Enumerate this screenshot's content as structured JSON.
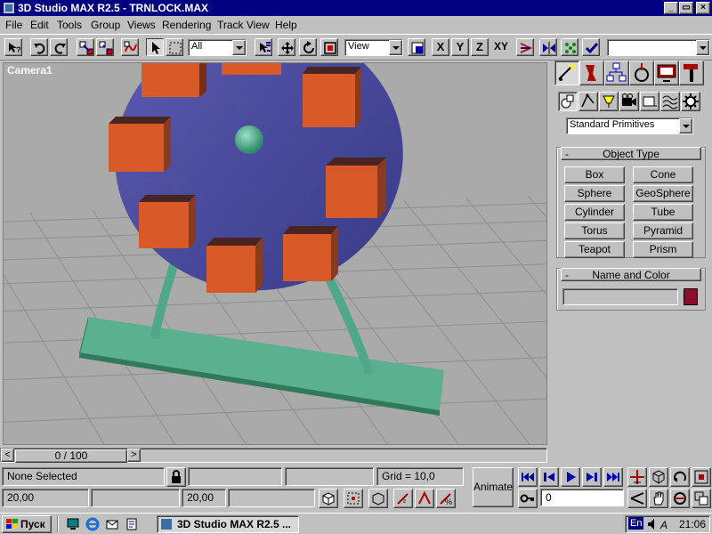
{
  "window": {
    "title": "3D Studio MAX R2.5 - TRNLOCK.MAX",
    "min_label": "_",
    "max_label": "▭",
    "close_label": "×"
  },
  "menu": [
    "File",
    "Edit",
    "Tools",
    "Group",
    "Views",
    "Rendering",
    "Track View",
    "Help"
  ],
  "toolbar": {
    "selection_filter": "All",
    "reference_coord": "View",
    "axis_x": "X",
    "axis_y": "Y",
    "axis_z": "Z",
    "axis_xy": "XY",
    "named_selection": ""
  },
  "viewport": {
    "label": "Camera1"
  },
  "command_panel": {
    "category": "Standard Primitives",
    "object_type_title": "Object Type",
    "buttons": [
      "Box",
      "Cone",
      "Sphere",
      "GeoSphere",
      "Cylinder",
      "Tube",
      "Torus",
      "Pyramid",
      "Teapot",
      "Prism"
    ],
    "name_color_title": "Name and Color",
    "name_value": "",
    "color": "#8b0f2a",
    "rollout_collapse": "-"
  },
  "time_slider": {
    "position": "0 / 100",
    "left_arrow": "<",
    "right_arrow": ">"
  },
  "status": {
    "selection": "None Selected",
    "grid": "Grid = 10,0",
    "coord_x": "20,00",
    "coord_y": "20,00",
    "animate_label": "Animate",
    "frame_value": "0"
  },
  "taskbar": {
    "start_label": "Пуск",
    "task_label": "3D Studio MAX R2.5 ...",
    "lang": "En",
    "clock": "21:06"
  },
  "colors": {
    "titlebar": "#000080",
    "wheel": "#4a4a9a",
    "boxes": "#d85a28",
    "base": "#5bb08f"
  }
}
